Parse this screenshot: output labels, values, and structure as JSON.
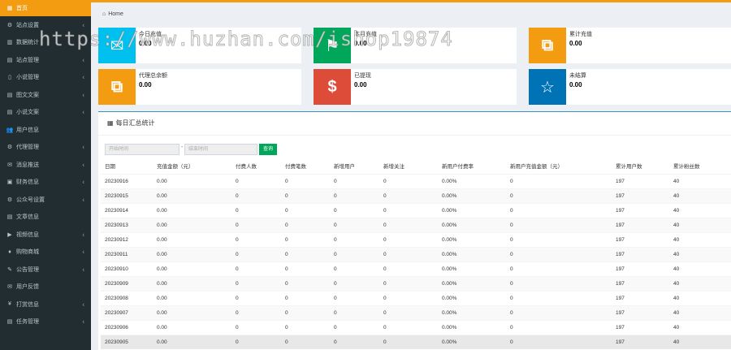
{
  "sidebar": {
    "items": [
      {
        "label": "首页",
        "icon": "dashboard-icon",
        "glyph": "▦",
        "chevron": false,
        "active": true
      },
      {
        "label": "站点设置",
        "icon": "gear-icon",
        "glyph": "⚙",
        "chevron": true
      },
      {
        "label": "数据统计",
        "icon": "bar-chart-icon",
        "glyph": "▥",
        "chevron": false
      },
      {
        "label": "站点管理",
        "icon": "list-icon",
        "glyph": "▤",
        "chevron": true
      },
      {
        "label": "小说管理",
        "icon": "book-icon",
        "glyph": "▯",
        "chevron": true
      },
      {
        "label": "图文文案",
        "icon": "file-icon",
        "glyph": "▤",
        "chevron": true
      },
      {
        "label": "小说文案",
        "icon": "doc-icon",
        "glyph": "▤",
        "chevron": true
      },
      {
        "label": "用户信息",
        "icon": "users-icon",
        "glyph": "👥",
        "chevron": false
      },
      {
        "label": "代理管理",
        "icon": "gears-icon",
        "glyph": "⚙",
        "chevron": true
      },
      {
        "label": "消息推送",
        "icon": "chat-icon",
        "glyph": "✉",
        "chevron": true
      },
      {
        "label": "财务信息",
        "icon": "money-icon",
        "glyph": "▣",
        "chevron": true
      },
      {
        "label": "公众号设置",
        "icon": "cogs-icon",
        "glyph": "⚙",
        "chevron": true
      },
      {
        "label": "文章信息",
        "icon": "article-icon",
        "glyph": "▤",
        "chevron": false
      },
      {
        "label": "视频信息",
        "icon": "video-icon",
        "glyph": "▶",
        "chevron": true
      },
      {
        "label": "购物商城",
        "icon": "shop-icon",
        "glyph": "♦",
        "chevron": true
      },
      {
        "label": "公告管理",
        "icon": "bullhorn-icon",
        "glyph": "✎",
        "chevron": true
      },
      {
        "label": "用户反馈",
        "icon": "comment-icon",
        "glyph": "✉",
        "chevron": false
      },
      {
        "label": "打赏信息",
        "icon": "yen-icon",
        "glyph": "¥",
        "chevron": true
      },
      {
        "label": "任务管理",
        "icon": "tasks-icon",
        "glyph": "▤",
        "chevron": true
      }
    ]
  },
  "breadcrumb": {
    "home": "Home"
  },
  "stats": [
    {
      "label": "今日充值",
      "value": "0.00",
      "icon": "envelope-icon",
      "glyph": "✉",
      "color": "#00c0ef"
    },
    {
      "label": "本月充值",
      "value": "0.00",
      "icon": "flag-icon",
      "glyph": "⚑",
      "color": "#00a65a"
    },
    {
      "label": "累计充值",
      "value": "0.00",
      "icon": "copy-icon",
      "glyph": "⧉",
      "color": "#f39c12"
    },
    {
      "label": "代理总余额",
      "value": "0.00",
      "icon": "copy-icon",
      "glyph": "⧉",
      "color": "#f39c12"
    },
    {
      "label": "已提现",
      "value": "0.00",
      "icon": "dollar-icon",
      "glyph": "$",
      "color": "#dd4b39"
    },
    {
      "label": "未结算",
      "value": "0.00",
      "icon": "star-icon",
      "glyph": "☆",
      "color": "#0073b7"
    }
  ],
  "panel": {
    "title": "每日汇总统计"
  },
  "filter": {
    "start_placeholder": "开始时间",
    "end_placeholder": "结束时间",
    "separator": "-",
    "query_label": "查询"
  },
  "table": {
    "headers": [
      "日期",
      "充值金额（元）",
      "付费人数",
      "付费笔数",
      "新增用户",
      "新增关注",
      "新用户付费率",
      "新用户充值金额（元）",
      "累计用户数",
      "累计粉丝数"
    ],
    "rows": [
      [
        "20230916",
        "0.00",
        "0",
        "0",
        "0",
        "0",
        "0.00%",
        "0",
        "197",
        "40"
      ],
      [
        "20230915",
        "0.00",
        "0",
        "0",
        "0",
        "0",
        "0.00%",
        "0",
        "197",
        "40"
      ],
      [
        "20230914",
        "0.00",
        "0",
        "0",
        "0",
        "0",
        "0.00%",
        "0",
        "197",
        "40"
      ],
      [
        "20230913",
        "0.00",
        "0",
        "0",
        "0",
        "0",
        "0.00%",
        "0",
        "197",
        "40"
      ],
      [
        "20230912",
        "0.00",
        "0",
        "0",
        "0",
        "0",
        "0.00%",
        "0",
        "197",
        "40"
      ],
      [
        "20230911",
        "0.00",
        "0",
        "0",
        "0",
        "0",
        "0.00%",
        "0",
        "197",
        "40"
      ],
      [
        "20230910",
        "0.00",
        "0",
        "0",
        "0",
        "0",
        "0.00%",
        "0",
        "197",
        "40"
      ],
      [
        "20230909",
        "0.00",
        "0",
        "0",
        "0",
        "0",
        "0.00%",
        "0",
        "197",
        "40"
      ],
      [
        "20230908",
        "0.00",
        "0",
        "0",
        "0",
        "0",
        "0.00%",
        "0",
        "197",
        "40"
      ],
      [
        "20230907",
        "0.00",
        "0",
        "0",
        "0",
        "0",
        "0.00%",
        "0",
        "197",
        "40"
      ],
      [
        "20230906",
        "0.00",
        "0",
        "0",
        "0",
        "0",
        "0.00%",
        "0",
        "197",
        "40"
      ],
      [
        "20230905",
        "0.00",
        "0",
        "0",
        "0",
        "0",
        "0.00%",
        "0",
        "197",
        "40"
      ]
    ]
  },
  "watermark": "https://www.huzhan.com/ishop19874",
  "colors": {
    "sidebar_bg": "#222d32",
    "active": "#f39c12",
    "accent": "#3c8dbc",
    "button": "#00a65a"
  }
}
